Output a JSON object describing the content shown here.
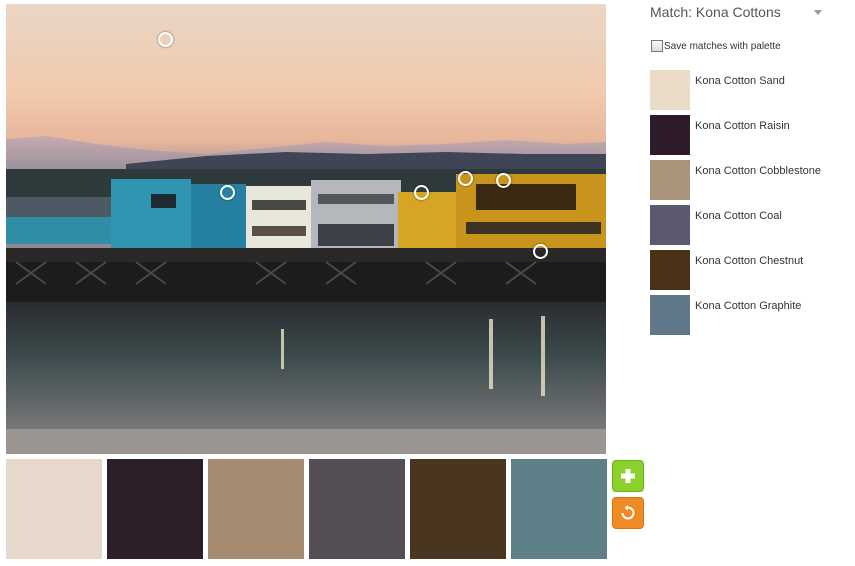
{
  "matches": {
    "title": "Match: Kona Cottons",
    "save_label": "Save matches with palette",
    "items": [
      {
        "label": "Kona Cotton Sand",
        "color": "#ebdcc8"
      },
      {
        "label": "Kona Cotton Raisin",
        "color": "#2e1b29"
      },
      {
        "label": "Kona Cotton Cobblestone",
        "color": "#a8957c"
      },
      {
        "label": "Kona Cotton Coal",
        "color": "#5b596d"
      },
      {
        "label": "Kona Cotton Chestnut",
        "color": "#4a3218"
      },
      {
        "label": "Kona Cotton Graphite",
        "color": "#61778a"
      }
    ]
  },
  "palette": {
    "swatches": [
      {
        "color": "#e6d9cb"
      },
      {
        "color": "#2c1f28"
      },
      {
        "color": "#a48b71"
      },
      {
        "color": "#544e54"
      },
      {
        "color": "#4a3520"
      },
      {
        "color": "#5e8189"
      }
    ]
  },
  "buttons": {
    "add_icon": "plus-icon",
    "reset_icon": "rotate-icon"
  }
}
